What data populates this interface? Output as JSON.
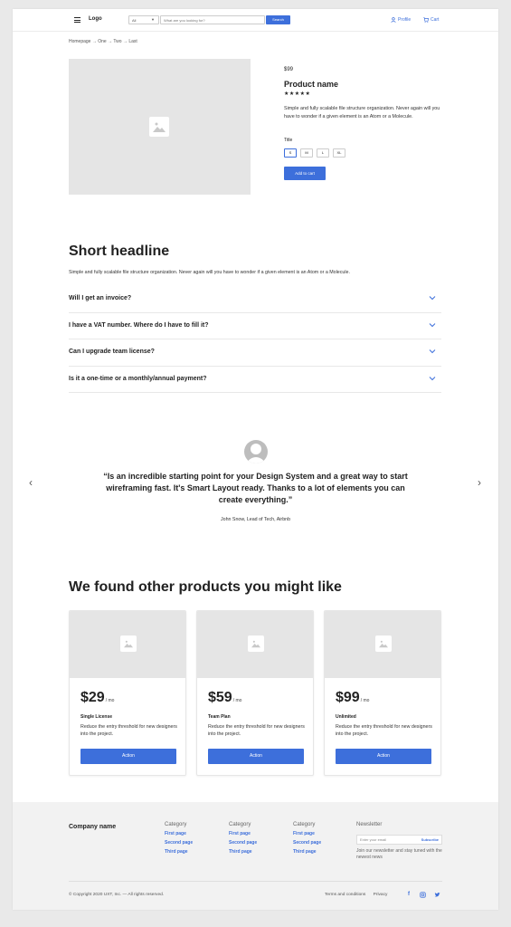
{
  "header": {
    "logo": "Logo",
    "search_category": "All",
    "search_placeholder": "What are you looking for?",
    "search_button": "Search",
    "profile": "Profile",
    "cart": "Cart",
    "accent": "#3d6fdb"
  },
  "breadcrumb": "Homepage → One → Two → Last",
  "product": {
    "price": "$99",
    "name": "Product name",
    "stars": "★★★★★",
    "description": "Simple and fully scalable file structure organization. Never again will you have to wonder if a given element is an Atom or a Molecule.",
    "size_title": "Title",
    "sizes": [
      "S",
      "M",
      "L",
      "XL"
    ],
    "selected_size": "S",
    "add_to_cart": "Add to cart"
  },
  "faq": {
    "title": "Short headline",
    "subtitle": "Simple and fully scalable file structure organization. Never again will you have to wonder if a given element is an Atom or a Molecule.",
    "items": [
      "Will I get an invoice?",
      "I have a VAT number. Where do I have to fill it?",
      "Can I upgrade team license?",
      "Is it a one-time or a monthly/annual payment?"
    ]
  },
  "testimonial": {
    "prev": "‹",
    "next": "›",
    "quote": "“Is an incredible starting point for your Design System and a great way to start wireframing fast. It's Smart Layout ready. Thanks to a lot of elements you can create everything.”",
    "author": "John Snow, Lead of Tech, Airbnb"
  },
  "related": {
    "title": "We found other products you might like",
    "cards": [
      {
        "price": "$29",
        "period": "/ mo",
        "name": "Single License",
        "desc": "Reduce the entry threshold for new designers into the project.",
        "action": "Action"
      },
      {
        "price": "$59",
        "period": "/ mo",
        "name": "Team Plan",
        "desc": "Reduce the entry threshold for new designers into the project.",
        "action": "Action"
      },
      {
        "price": "$99",
        "period": "/ mo",
        "name": "Unlimited",
        "desc": "Reduce the entry threshold for new designers into the project.",
        "action": "Action"
      }
    ]
  },
  "footer": {
    "company": "Company name",
    "columns": [
      {
        "title": "Category",
        "links": [
          "First page",
          "Second page",
          "Third page"
        ]
      },
      {
        "title": "Category",
        "links": [
          "First page",
          "Second page",
          "Third page"
        ]
      },
      {
        "title": "Category",
        "links": [
          "First page",
          "Second page",
          "Third page"
        ]
      }
    ],
    "newsletter_title": "Newsletter",
    "email_placeholder": "Enter your email",
    "subscribe": "Subscribe",
    "newsletter_text": "Join our newsletter and stay tuned with the newest news",
    "copyright": "© Copyright 2020 UXT, Inc. — All rights reserved.",
    "terms": "Terms and conditions",
    "privacy": "Privacy",
    "social": [
      "facebook-icon",
      "instagram-icon",
      "twitter-icon"
    ]
  }
}
